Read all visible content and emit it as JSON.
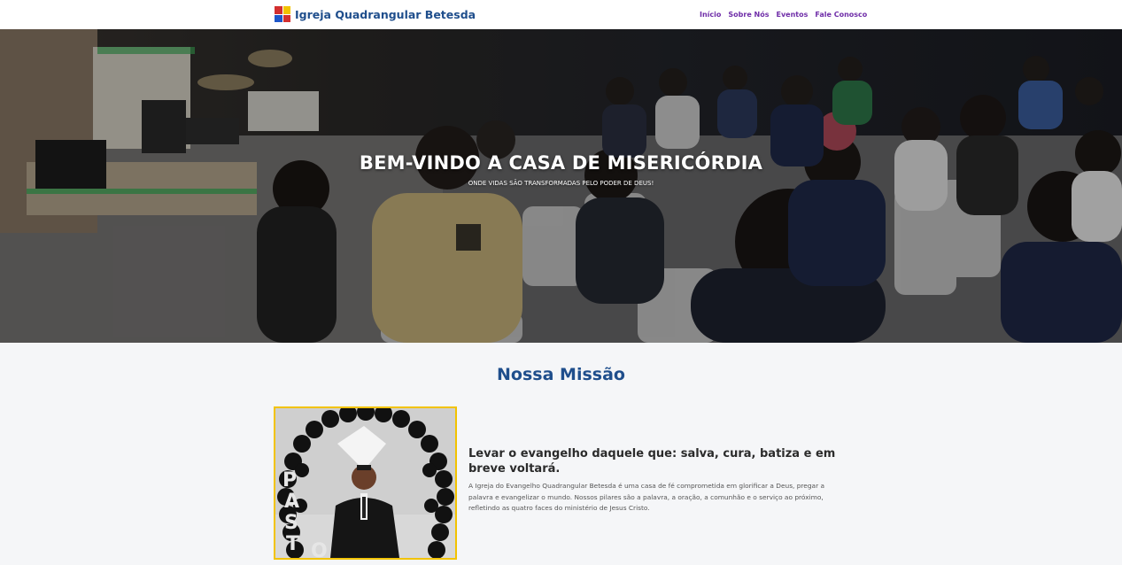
{
  "brand": {
    "name": "Igreja Quadrangular Betesda",
    "logo_icon": "quadrangular-logo-icon"
  },
  "nav": {
    "items": [
      "Início",
      "Sobre Nós",
      "Eventos",
      "Fale Conosco"
    ]
  },
  "hero": {
    "title": "BEM-VINDO A CASA DE MISERICÓRDIA",
    "subtitle": "ONDE VIDAS SÃO TRANSFORMADAS PELO PODER DE DEUS!"
  },
  "mission": {
    "title": "Nossa Missão",
    "heading": "Levar o evangelho daquele que: salva, cura, batiza e em breve voltará.",
    "text": "A Igreja do Evangelho Quadrangular Betesda é uma casa de fé comprometida em glorificar a Deus, pregar a palavra e evangelizar o mundo. Nossos pilares são a palavra, a oração, a comunhão e o serviço ao próximo, refletindo as quatro faces do ministério de Jesus Cristo."
  },
  "colors": {
    "brand": "#1f4e8c",
    "nav_link": "#6f2da8",
    "photo_border": "#f2c300"
  }
}
